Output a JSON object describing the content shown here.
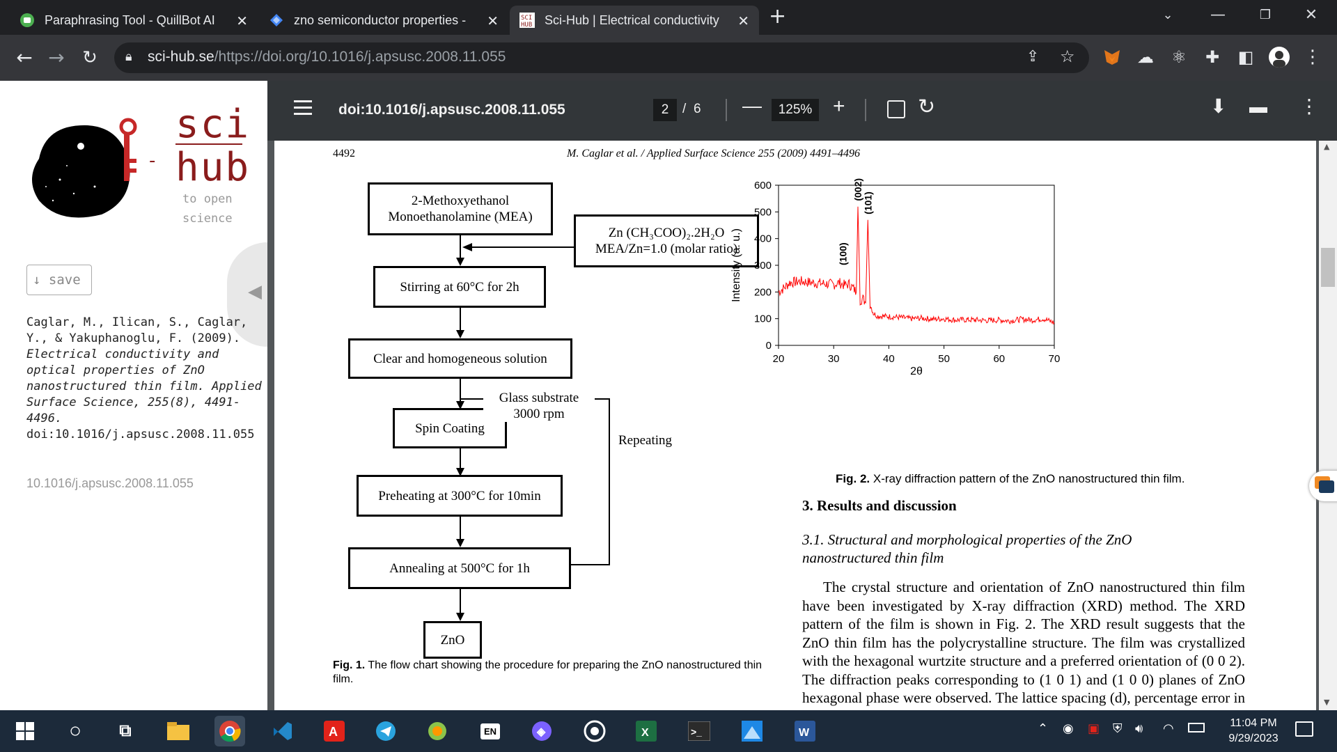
{
  "browser": {
    "tabs": [
      {
        "title": "Paraphrasing Tool - QuillBot AI",
        "icon": "quillbot-icon"
      },
      {
        "title": "zno semiconductor properties -",
        "icon": "search-engine-icon"
      },
      {
        "title": "Sci-Hub | Electrical conductivity",
        "icon": "scihub-icon"
      }
    ],
    "url_host": "sci-hub.se",
    "url_path": "/https://doi.org/10.1016/j.apsusc.2008.11.055"
  },
  "scihub": {
    "logo_top": "sci",
    "logo_bottom": "hub",
    "logo_dash": "-",
    "tagline_1": "to open",
    "tagline_2": "science",
    "save_label": "↓ save",
    "citation_authors": "Caglar, M., Ilican, S., Caglar, Y., & Yakuphanoglu, F. (2009).",
    "citation_title": "Electrical conductivity and optical properties of ZnO nanostructured thin film.",
    "citation_journal": "Applied Surface Science, 255(8), 4491-4496.",
    "citation_doi": "doi:10.1016/j.apsusc.2008.11.055",
    "doi_link": "10.1016/j.apsusc.2008.11.055"
  },
  "pdf": {
    "title": "doi:10.1016/j.apsusc.2008.11.055",
    "page_current": "2",
    "page_sep": "/",
    "page_total": "6",
    "zoom": "125%"
  },
  "paper": {
    "page_number": "4492",
    "running_header": "M. Caglar et al. / Applied Surface Science 255 (2009) 4491–4496",
    "flow": {
      "reagents_1": "2-Methoxyethanol",
      "reagents_2": "Monoethanolamine (MEA)",
      "salt_1": "Zn (CH₃COO)₂.2H₂O",
      "salt_2": "MEA/Zn=1.0 (molar ratio)",
      "stirring": "Stirring at 60°C for 2h",
      "clear": "Clear and homogeneous solution",
      "spin": "Spin Coating",
      "glass_1": "Glass substrate",
      "glass_2": "3000 rpm",
      "repeating": "Repeating",
      "preheat": "Preheating at 300°C for 10min",
      "anneal": "Annealing at 500°C for 1h",
      "product": "ZnO"
    },
    "fig1_label": "Fig. 1.",
    "fig1_caption": "The flow chart showing the procedure for preparing the ZnO nanostructured thin film.",
    "fig2_label": "Fig. 2.",
    "fig2_caption": "X-ray diffraction pattern of the ZnO nanostructured thin film.",
    "section_title": "3. Results and discussion",
    "subsection_title": "3.1. Structural and morphological properties of the ZnO nanostructured thin film",
    "body": "The crystal structure and orientation of ZnO nanostructured thin film have been investigated by X-ray diffraction (XRD) method. The XRD pattern of the film is shown in Fig. 2. The XRD result suggests that the ZnO thin film has the polycrystalline structure. The film was crystallized with the hexagonal wurtzite structure and a preferred orientation of (0 0 2). The diffraction peaks corresponding to (1 0 1) and (1 0 0) planes of ZnO hexagonal phase were observed. The lattice spacing (d), percentage error in d"
  },
  "chart_data": {
    "type": "line",
    "xlabel": "2θ",
    "ylabel": "Intensity (a. u.)",
    "xlim": [
      20,
      70
    ],
    "ylim": [
      0,
      600
    ],
    "xticks": [
      20,
      30,
      40,
      50,
      60,
      70
    ],
    "yticks": [
      0,
      100,
      200,
      300,
      400,
      500,
      600
    ],
    "color": "#ff0000",
    "x": [
      20,
      21,
      22,
      24,
      26,
      28,
      30,
      31,
      32,
      32.8,
      33.5,
      34.1,
      34.4,
      34.8,
      35.3,
      35.8,
      36.2,
      36.6,
      37.2,
      38,
      40,
      42,
      44,
      46,
      48,
      50,
      52,
      54,
      56,
      58,
      60,
      62,
      64,
      66,
      68,
      70
    ],
    "y": [
      200,
      215,
      235,
      240,
      235,
      232,
      228,
      235,
      225,
      230,
      215,
      200,
      520,
      170,
      175,
      160,
      470,
      155,
      120,
      110,
      108,
      105,
      100,
      102,
      98,
      100,
      95,
      96,
      95,
      93,
      95,
      92,
      98,
      95,
      100,
      85
    ],
    "annotations": [
      {
        "label": "(100)",
        "x": 31.7
      },
      {
        "label": "(002)",
        "x": 34.4
      },
      {
        "label": "(101)",
        "x": 36.2
      }
    ]
  },
  "taskbar": {
    "apps": [
      "start-icon",
      "search-icon",
      "task-view-icon",
      "file-explorer-icon",
      "chrome-icon",
      "vscode-icon",
      "acrobat-icon",
      "telegram-icon",
      "app-icon",
      "language-icon",
      "app-icon",
      "whatsapp-icon",
      "excel-icon",
      "terminal-icon",
      "app-icon",
      "word-icon"
    ],
    "lang": "EN",
    "time": "11:04 PM",
    "date": "9/29/2023"
  }
}
